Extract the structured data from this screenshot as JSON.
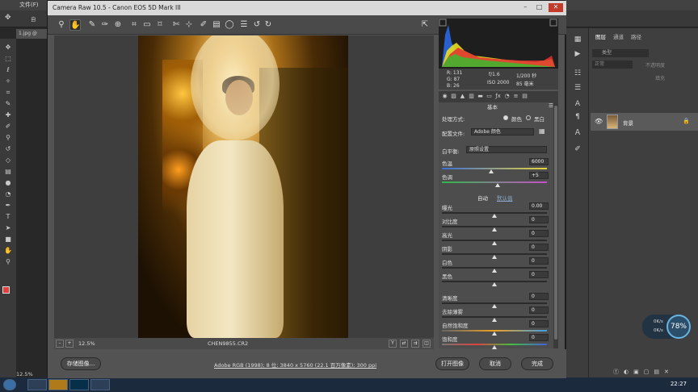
{
  "ps": {
    "menu": [
      "文件(F)"
    ],
    "doc_tab": "1.jpg @",
    "options_label": "自",
    "zoom": "12.5%",
    "layers_tabs": [
      "图层",
      "通道",
      "路径"
    ],
    "search_placeholder": "类型",
    "blend_mode": "正常",
    "opacity": "不透明度",
    "fill": "填充",
    "layer_name": "背景",
    "clock": "22:27"
  },
  "acr": {
    "title": "Camera Raw 10.5 -  Canon EOS 5D Mark III",
    "rgb": {
      "r": "131",
      "g": "87",
      "b": "26"
    },
    "exif": {
      "aperture": "f/1.6",
      "shutter": "1/200 秒",
      "iso": "ISO 2000",
      "focal": "85 毫米"
    },
    "panel_title": "基本",
    "treatment_label": "处理方式:",
    "treatment_color": "颜色",
    "treatment_bw": "黑白",
    "profile_label": "配置文件:",
    "profile_value": "Adobe 颜色",
    "wb_label": "白平衡:",
    "wb_value": "原照设置",
    "auto_label": "自动",
    "default_label": "默认值",
    "sliders": [
      {
        "label": "色温",
        "value": "6000"
      },
      {
        "label": "色调",
        "value": "+5"
      },
      {
        "label": "曝光",
        "value": "0.00"
      },
      {
        "label": "对比度",
        "value": "0"
      },
      {
        "label": "高光",
        "value": "0"
      },
      {
        "label": "阴影",
        "value": "0"
      },
      {
        "label": "白色",
        "value": "0"
      },
      {
        "label": "黑色",
        "value": "0"
      },
      {
        "label": "清晰度",
        "value": "0"
      },
      {
        "label": "去除薄雾",
        "value": "0"
      },
      {
        "label": "自然饱和度",
        "value": "0"
      },
      {
        "label": "饱和度",
        "value": "0"
      }
    ],
    "zoom": "12.5%",
    "filename": "CHEN9855.CR2",
    "save_btn": "存储图像...",
    "workflow": "Adobe RGB (1998); 8 位; 3840 x 5760 (22.1 百万像素); 300 ppi",
    "open_btn": "打开图像",
    "cancel_btn": "取消",
    "done_btn": "完成"
  },
  "net": {
    "up": "0K/s",
    "down": "0K/s",
    "cpu": "78%"
  },
  "colors": {
    "accent": "#1a73d9",
    "panel": "#4d4d4d",
    "close": "#c43b2c"
  }
}
